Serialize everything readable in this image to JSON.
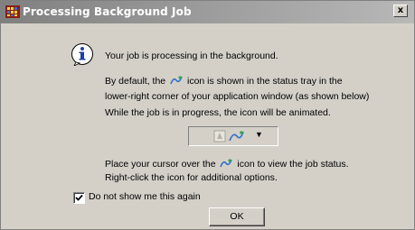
{
  "window": {
    "title": "Processing Background Job",
    "close_label": "x"
  },
  "message": {
    "line1": "Your job is processing in the background.",
    "line2_before": "By default, the",
    "line2_after": "icon is shown in the status tray in the",
    "line3": "lower-right corner of your application window (as shown below)",
    "line4": "While the job is in progress, the icon will be animated.",
    "line5_before": "Place your cursor over the",
    "line5_after": "icon to view the job status.",
    "line6": "Right-click the icon for additional options."
  },
  "tray": {
    "dropdown_glyph": "▼"
  },
  "checkbox": {
    "label": "Do not show me this again",
    "checked": true
  },
  "ok_button": {
    "label": "OK"
  }
}
